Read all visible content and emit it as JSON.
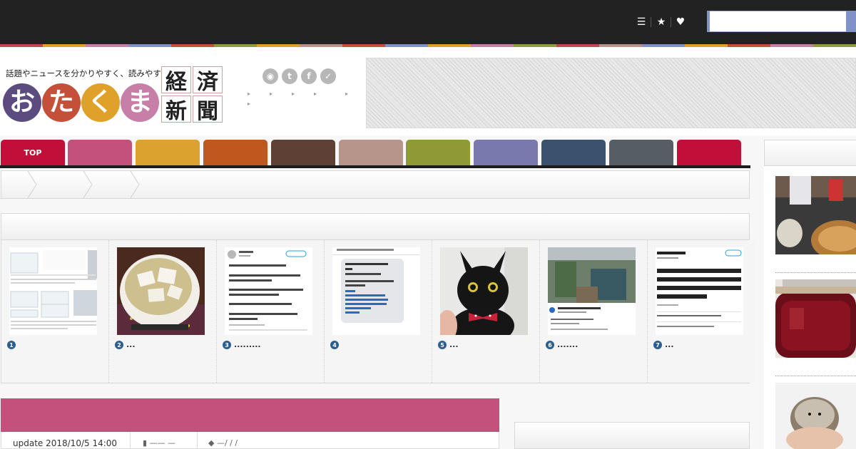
{
  "header": {
    "tagline": "話題やニュースを分かりやすく、読みやすく。",
    "logo_chars": [
      "お",
      "た",
      "く",
      "ま"
    ],
    "logo_colors": [
      "#5b4b7e",
      "#c4503a",
      "#e0a12a",
      "#c77fa8"
    ],
    "logo_kanji": [
      "経",
      "済",
      "新",
      "聞"
    ],
    "social_icons": [
      "rss-icon",
      "twitter-icon",
      "facebook-icon",
      "feedly-icon"
    ],
    "social_glyphs": [
      "◉",
      "t",
      "f",
      "✓"
    ],
    "links": [
      "",
      "",
      "",
      "",
      "",
      ""
    ]
  },
  "topbar": {
    "icons": [
      "list-icon",
      "star-icon",
      "heart-icon"
    ],
    "icon_glyphs": [
      "☰",
      "★",
      "♥"
    ],
    "search_value": ""
  },
  "stripe_colors": [
    "#c24a55",
    "#e0a12a",
    "#c77fa8",
    "#7f93c8",
    "#c4503a",
    "#8e9c3c",
    "#e0a12a",
    "#b9938a",
    "#c4503a",
    "#7f93c8",
    "#e0a12a",
    "#c77fa8",
    "#8e9c3c",
    "#c24a55",
    "#b9938a",
    "#7f93c8",
    "#e0a12a",
    "#c4503a",
    "#c77fa8",
    "#8e9c3c"
  ],
  "nav": {
    "tabs": [
      {
        "label": "TOP",
        "color": "#c0103a"
      },
      {
        "label": "",
        "color": "#c4507c"
      },
      {
        "label": "",
        "color": "#dba22e"
      },
      {
        "label": "",
        "color": "#c0571f"
      },
      {
        "label": "",
        "color": "#5e4034"
      },
      {
        "label": "",
        "color": "#b8958a"
      },
      {
        "label": "",
        "color": "#8f9a37"
      },
      {
        "label": "",
        "color": "#7979ae"
      },
      {
        "label": "",
        "color": "#3a526d"
      },
      {
        "label": "",
        "color": "#565d64"
      },
      {
        "label": "",
        "color": "#c0103a"
      }
    ]
  },
  "ranking": {
    "items": [
      {
        "rank": "1",
        "title": ""
      },
      {
        "rank": "2",
        "title": "..."
      },
      {
        "rank": "3",
        "title": "........."
      },
      {
        "rank": "4",
        "title": ""
      },
      {
        "rank": "5",
        "title": "..."
      },
      {
        "rank": "6",
        "title": "......."
      },
      {
        "rank": "7",
        "title": "..."
      }
    ]
  },
  "article": {
    "update_label": "update  2018/10/5 14:00",
    "category": "—— —",
    "tag": "—/ / /"
  }
}
